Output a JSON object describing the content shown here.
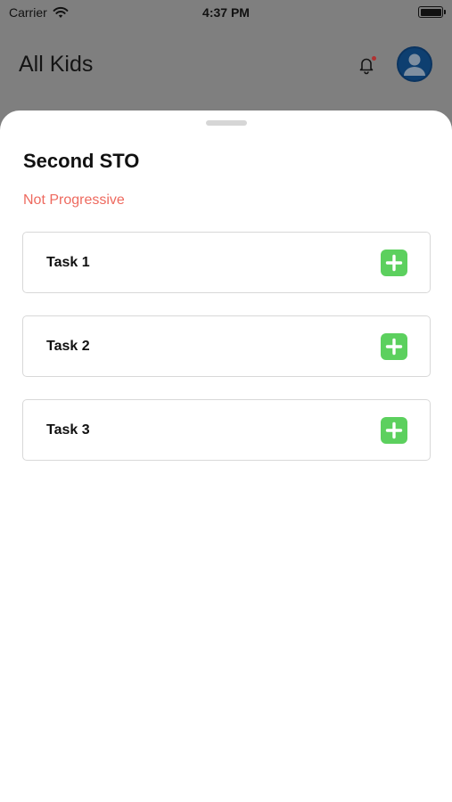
{
  "status_bar": {
    "carrier": "Carrier",
    "time": "4:37 PM"
  },
  "header": {
    "title": "All Kids",
    "notification_icon": "bell-icon",
    "profile_icon": "user-avatar-icon"
  },
  "sheet": {
    "title": "Second STO",
    "status": "Not Progressive",
    "tasks": [
      {
        "label": "Task 1",
        "action_icon": "plus-icon"
      },
      {
        "label": "Task 2",
        "action_icon": "plus-icon"
      },
      {
        "label": "Task 3",
        "action_icon": "plus-icon"
      }
    ]
  },
  "colors": {
    "overlay": "#7f7f7f",
    "status_red": "#ee6a5f",
    "add_green": "#5cd05e",
    "avatar_blue": "#0e3f70"
  }
}
